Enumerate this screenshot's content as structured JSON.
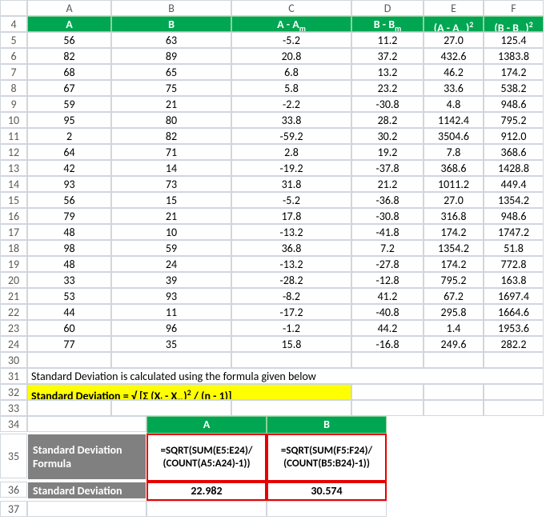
{
  "col_headers": [
    "A",
    "B",
    "C",
    "D",
    "E",
    "F"
  ],
  "visible_row_numbers": [
    4,
    5,
    6,
    7,
    8,
    9,
    10,
    11,
    12,
    13,
    14,
    15,
    16,
    17,
    18,
    19,
    20,
    21,
    22,
    23,
    24,
    30,
    31,
    32,
    33,
    34,
    35,
    36,
    37
  ],
  "table_headers": {
    "A": "A",
    "B": "B",
    "C": "A - A",
    "D": "B - B",
    "E": "(A - A",
    "F": "(B - B"
  },
  "table_header_sub": "m",
  "table_header_sup": "2",
  "rows": [
    {
      "A": "56",
      "B": "63",
      "C": "-5.2",
      "D": "11.2",
      "E": "27.0",
      "F": "125.4"
    },
    {
      "A": "82",
      "B": "89",
      "C": "20.8",
      "D": "37.2",
      "E": "432.6",
      "F": "1383.8"
    },
    {
      "A": "68",
      "B": "65",
      "C": "6.8",
      "D": "13.2",
      "E": "46.2",
      "F": "174.2"
    },
    {
      "A": "67",
      "B": "75",
      "C": "5.8",
      "D": "23.2",
      "E": "33.6",
      "F": "538.2"
    },
    {
      "A": "59",
      "B": "21",
      "C": "-2.2",
      "D": "-30.8",
      "E": "4.8",
      "F": "948.6"
    },
    {
      "A": "95",
      "B": "80",
      "C": "33.8",
      "D": "28.2",
      "E": "1142.4",
      "F": "795.2"
    },
    {
      "A": "2",
      "B": "82",
      "C": "-59.2",
      "D": "30.2",
      "E": "3504.6",
      "F": "912.0"
    },
    {
      "A": "64",
      "B": "71",
      "C": "2.8",
      "D": "19.2",
      "E": "7.8",
      "F": "368.6"
    },
    {
      "A": "42",
      "B": "14",
      "C": "-19.2",
      "D": "-37.8",
      "E": "368.6",
      "F": "1428.8"
    },
    {
      "A": "93",
      "B": "73",
      "C": "31.8",
      "D": "21.2",
      "E": "1011.2",
      "F": "449.4"
    },
    {
      "A": "56",
      "B": "15",
      "C": "-5.2",
      "D": "-36.8",
      "E": "27.0",
      "F": "1354.2"
    },
    {
      "A": "79",
      "B": "21",
      "C": "17.8",
      "D": "-30.8",
      "E": "316.8",
      "F": "948.6"
    },
    {
      "A": "48",
      "B": "10",
      "C": "-13.2",
      "D": "-41.8",
      "E": "174.2",
      "F": "1747.2"
    },
    {
      "A": "98",
      "B": "59",
      "C": "36.8",
      "D": "7.2",
      "E": "1354.2",
      "F": "51.8"
    },
    {
      "A": "48",
      "B": "24",
      "C": "-13.2",
      "D": "-27.8",
      "E": "174.2",
      "F": "772.8"
    },
    {
      "A": "33",
      "B": "39",
      "C": "-28.2",
      "D": "-12.8",
      "E": "795.2",
      "F": "163.8"
    },
    {
      "A": "53",
      "B": "93",
      "C": "-8.2",
      "D": "41.2",
      "E": "67.2",
      "F": "1697.4"
    },
    {
      "A": "44",
      "B": "11",
      "C": "-17.2",
      "D": "-40.8",
      "E": "295.8",
      "F": "1664.6"
    },
    {
      "A": "60",
      "B": "96",
      "C": "-1.2",
      "D": "44.2",
      "E": "1.4",
      "F": "1953.6"
    },
    {
      "A": "77",
      "B": "35",
      "C": "15.8",
      "D": "-16.8",
      "E": "249.6",
      "F": "282.2"
    }
  ],
  "desc_line": "Standard Deviation is calculated using the formula given below",
  "formula_line_prefix": "Standard Deviation = √ [Σ (X",
  "formula_line_sub1": "i",
  "formula_line_mid": " - X",
  "formula_line_sub2": "m",
  "formula_line_suffix1": ")",
  "formula_line_sup": "2",
  "formula_line_suffix2": " / (n - 1)]",
  "block2": {
    "hA": "A",
    "hB": "B",
    "row_labels": {
      "formula": "Standard Deviation Formula",
      "result": "Standard Deviation"
    },
    "fA1": "=SQRT(SUM(E5:E24)/",
    "fA2": "(COUNT(A5:A24)-1))",
    "fB1": "=SQRT(SUM(F5:F24)/",
    "fB2": "(COUNT(B5:B24)-1))",
    "rA": "22.982",
    "rB": "30.574"
  },
  "row_nums_block2": {
    "r34": "34",
    "r35": "35",
    "r36": "36",
    "r37": "37",
    "r33": "33"
  }
}
